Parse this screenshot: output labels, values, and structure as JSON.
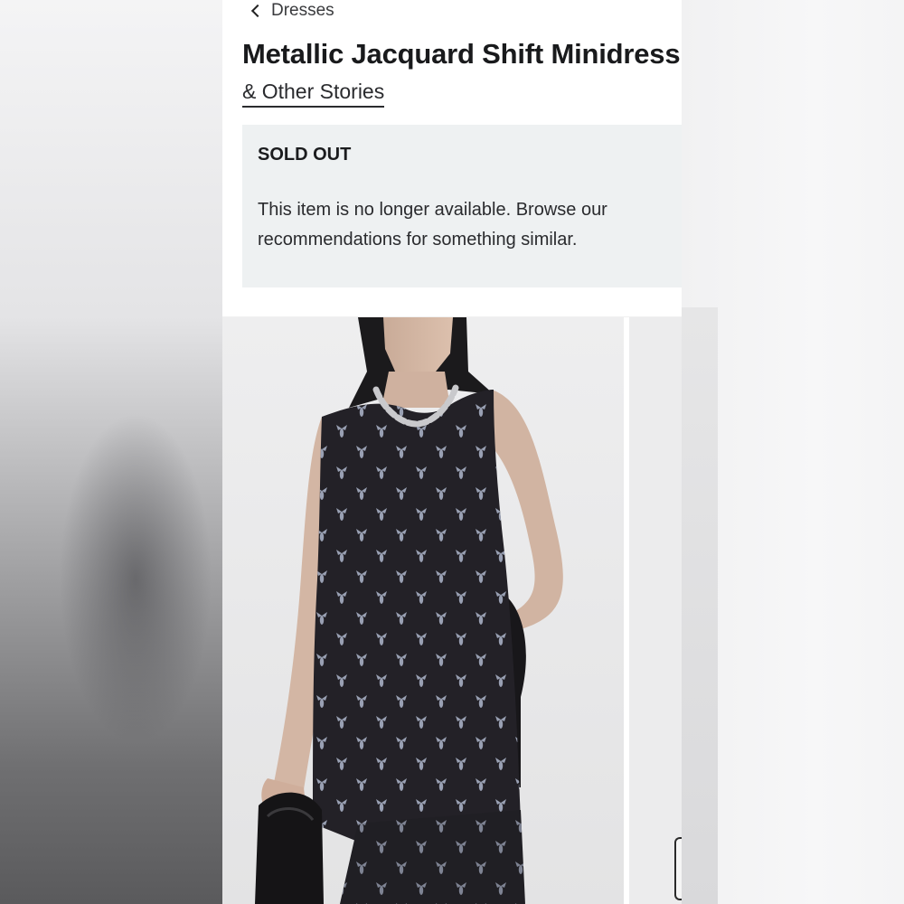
{
  "breadcrumb": {
    "label": "Dresses"
  },
  "product": {
    "title": "Metallic Jacquard Shift Minidress",
    "brand": "& Other Stories"
  },
  "notice": {
    "heading": "SOLD OUT",
    "body": "This item is no longer available. Browse our recommendations for something similar."
  },
  "gallery": {
    "images": [
      "model wearing black jacquard minidress",
      "next product image"
    ]
  },
  "colors": {
    "notice_bg": "#eef1f2",
    "dress": "#232127",
    "motif": "#9aa3b8"
  },
  "icons": {
    "back": "chevron-left-icon"
  }
}
